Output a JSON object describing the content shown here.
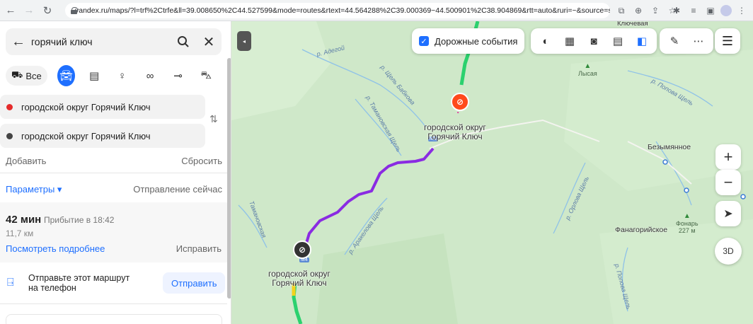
{
  "browser": {
    "url": "yandex.ru/maps/?l=trf%2Ctrfe&ll=39.008650%2C44.527599&mode=routes&rtext=44.564288%2C39.000369~44.500901%2C38.904869&rtt=auto&ruri=~&source=serp_navig..."
  },
  "search": {
    "query": "горячий ключ"
  },
  "modes": {
    "all_label": "Все"
  },
  "route": {
    "from": "городской округ Горячий Ключ",
    "to": "городской округ Горячий Ключ",
    "add_label": "Добавить",
    "reset_label": "Сбросить",
    "params_label": "Параметры",
    "depart_label": "Отправление сейчас"
  },
  "result": {
    "duration": "42 мин",
    "arrival": "Прибытие в 18:42",
    "distance": "11,7 км",
    "details_link": "Посмотреть подробнее",
    "fix_label": "Исправить"
  },
  "send": {
    "text": "Отправьте этот маршрут на телефон",
    "button": "Отправить"
  },
  "map": {
    "traffic_label": "Дорожные события",
    "three_d_label": "3D",
    "zoom_in": "+",
    "zoom_out": "−",
    "labels": {
      "river_adegoy": "р. Адегой",
      "schel_babkova": "р. Щель Бабкова",
      "tamanskaya": "р. Тамановская Щель",
      "tamanskaya2": "Тамановская",
      "arakelova": "р. Аракелова Щель",
      "orlova": "р. Орлова Щель",
      "popova": "р. Попова Щель",
      "popova2": "р. Попова Щель",
      "pin_a_city": "городской округ\nГорячий Ключ",
      "pin_b_city": "городской округ\nГорячий Ключ",
      "bezymyannoe": "Безымянное",
      "fanagoriyskoe": "Фанагорийское",
      "klyuchevaya": "Ключевая",
      "lysaya": "Лысая",
      "fonar": "Фонарь",
      "fonar_h": "227 м",
      "road_1": "М4",
      "road_2": "М4"
    }
  },
  "colors": {
    "accent": "#1e6fff",
    "route": "#8a2be2",
    "map_bg": "#cfe8c9",
    "pin_start": "#333333",
    "pin_end": "#ff4a1c"
  }
}
